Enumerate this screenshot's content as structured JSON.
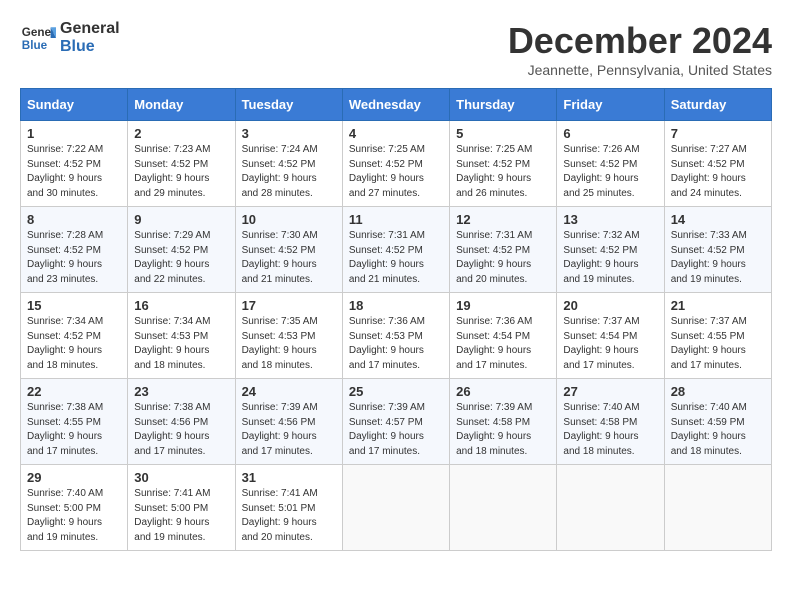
{
  "logo": {
    "general": "General",
    "blue": "Blue"
  },
  "title": "December 2024",
  "location": "Jeannette, Pennsylvania, United States",
  "headers": [
    "Sunday",
    "Monday",
    "Tuesday",
    "Wednesday",
    "Thursday",
    "Friday",
    "Saturday"
  ],
  "weeks": [
    [
      {
        "day": "1",
        "sunrise": "7:22 AM",
        "sunset": "4:52 PM",
        "daylight": "9 hours and 30 minutes."
      },
      {
        "day": "2",
        "sunrise": "7:23 AM",
        "sunset": "4:52 PM",
        "daylight": "9 hours and 29 minutes."
      },
      {
        "day": "3",
        "sunrise": "7:24 AM",
        "sunset": "4:52 PM",
        "daylight": "9 hours and 28 minutes."
      },
      {
        "day": "4",
        "sunrise": "7:25 AM",
        "sunset": "4:52 PM",
        "daylight": "9 hours and 27 minutes."
      },
      {
        "day": "5",
        "sunrise": "7:25 AM",
        "sunset": "4:52 PM",
        "daylight": "9 hours and 26 minutes."
      },
      {
        "day": "6",
        "sunrise": "7:26 AM",
        "sunset": "4:52 PM",
        "daylight": "9 hours and 25 minutes."
      },
      {
        "day": "7",
        "sunrise": "7:27 AM",
        "sunset": "4:52 PM",
        "daylight": "9 hours and 24 minutes."
      }
    ],
    [
      {
        "day": "8",
        "sunrise": "7:28 AM",
        "sunset": "4:52 PM",
        "daylight": "9 hours and 23 minutes."
      },
      {
        "day": "9",
        "sunrise": "7:29 AM",
        "sunset": "4:52 PM",
        "daylight": "9 hours and 22 minutes."
      },
      {
        "day": "10",
        "sunrise": "7:30 AM",
        "sunset": "4:52 PM",
        "daylight": "9 hours and 21 minutes."
      },
      {
        "day": "11",
        "sunrise": "7:31 AM",
        "sunset": "4:52 PM",
        "daylight": "9 hours and 21 minutes."
      },
      {
        "day": "12",
        "sunrise": "7:31 AM",
        "sunset": "4:52 PM",
        "daylight": "9 hours and 20 minutes."
      },
      {
        "day": "13",
        "sunrise": "7:32 AM",
        "sunset": "4:52 PM",
        "daylight": "9 hours and 19 minutes."
      },
      {
        "day": "14",
        "sunrise": "7:33 AM",
        "sunset": "4:52 PM",
        "daylight": "9 hours and 19 minutes."
      }
    ],
    [
      {
        "day": "15",
        "sunrise": "7:34 AM",
        "sunset": "4:52 PM",
        "daylight": "9 hours and 18 minutes."
      },
      {
        "day": "16",
        "sunrise": "7:34 AM",
        "sunset": "4:53 PM",
        "daylight": "9 hours and 18 minutes."
      },
      {
        "day": "17",
        "sunrise": "7:35 AM",
        "sunset": "4:53 PM",
        "daylight": "9 hours and 18 minutes."
      },
      {
        "day": "18",
        "sunrise": "7:36 AM",
        "sunset": "4:53 PM",
        "daylight": "9 hours and 17 minutes."
      },
      {
        "day": "19",
        "sunrise": "7:36 AM",
        "sunset": "4:54 PM",
        "daylight": "9 hours and 17 minutes."
      },
      {
        "day": "20",
        "sunrise": "7:37 AM",
        "sunset": "4:54 PM",
        "daylight": "9 hours and 17 minutes."
      },
      {
        "day": "21",
        "sunrise": "7:37 AM",
        "sunset": "4:55 PM",
        "daylight": "9 hours and 17 minutes."
      }
    ],
    [
      {
        "day": "22",
        "sunrise": "7:38 AM",
        "sunset": "4:55 PM",
        "daylight": "9 hours and 17 minutes."
      },
      {
        "day": "23",
        "sunrise": "7:38 AM",
        "sunset": "4:56 PM",
        "daylight": "9 hours and 17 minutes."
      },
      {
        "day": "24",
        "sunrise": "7:39 AM",
        "sunset": "4:56 PM",
        "daylight": "9 hours and 17 minutes."
      },
      {
        "day": "25",
        "sunrise": "7:39 AM",
        "sunset": "4:57 PM",
        "daylight": "9 hours and 17 minutes."
      },
      {
        "day": "26",
        "sunrise": "7:39 AM",
        "sunset": "4:58 PM",
        "daylight": "9 hours and 18 minutes."
      },
      {
        "day": "27",
        "sunrise": "7:40 AM",
        "sunset": "4:58 PM",
        "daylight": "9 hours and 18 minutes."
      },
      {
        "day": "28",
        "sunrise": "7:40 AM",
        "sunset": "4:59 PM",
        "daylight": "9 hours and 18 minutes."
      }
    ],
    [
      {
        "day": "29",
        "sunrise": "7:40 AM",
        "sunset": "5:00 PM",
        "daylight": "9 hours and 19 minutes."
      },
      {
        "day": "30",
        "sunrise": "7:41 AM",
        "sunset": "5:00 PM",
        "daylight": "9 hours and 19 minutes."
      },
      {
        "day": "31",
        "sunrise": "7:41 AM",
        "sunset": "5:01 PM",
        "daylight": "9 hours and 20 minutes."
      },
      null,
      null,
      null,
      null
    ]
  ]
}
